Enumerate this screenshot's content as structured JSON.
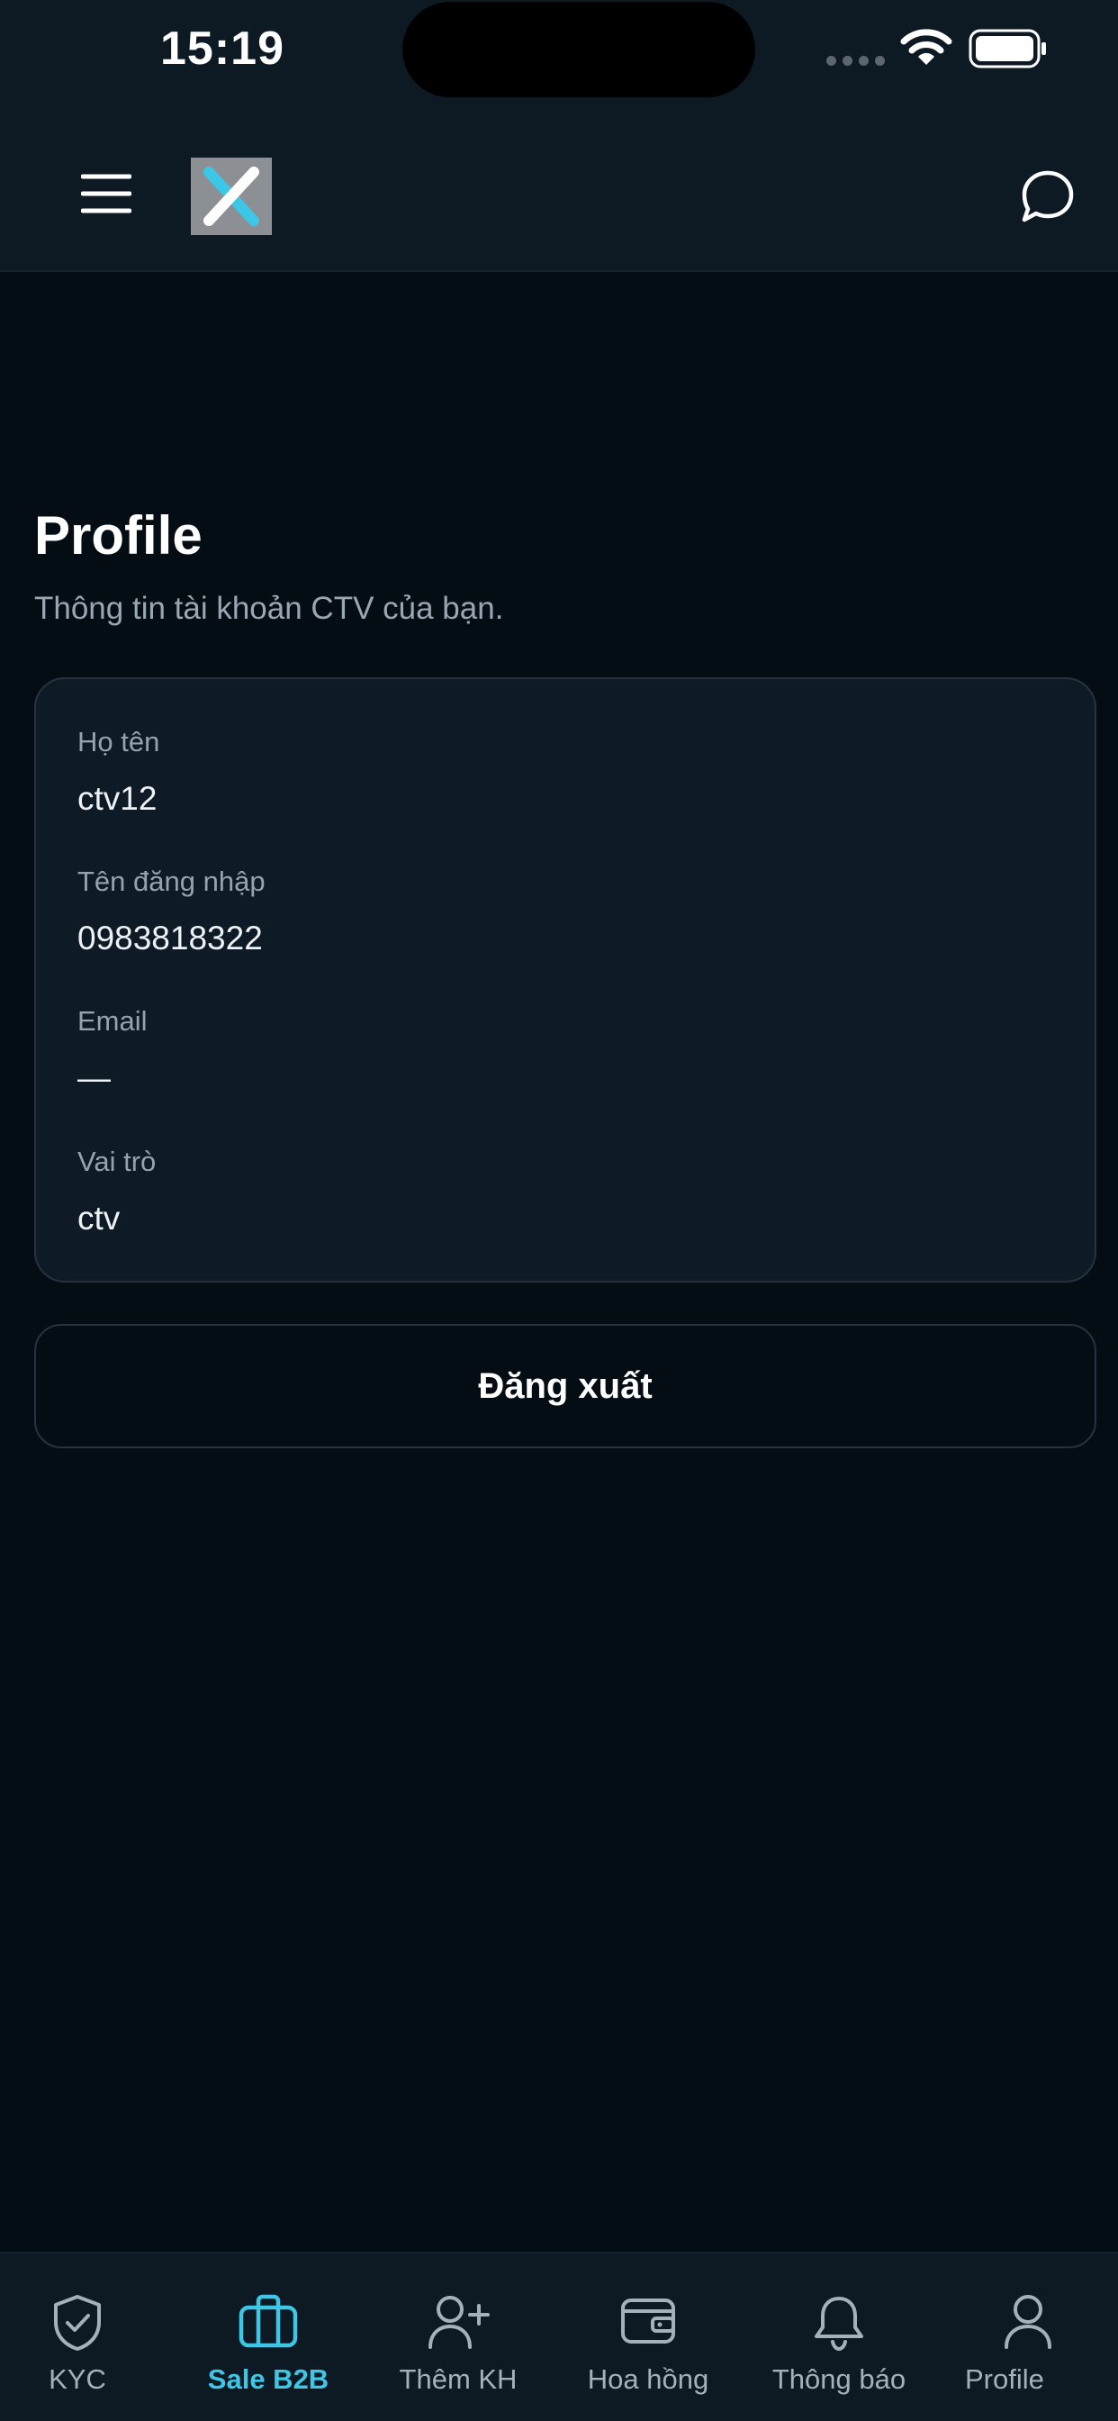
{
  "status_bar": {
    "time": "15:19"
  },
  "header": {
    "menu_icon": "hamburger-menu-icon",
    "logo": "x-logo",
    "chat_icon": "chat-bubble-icon"
  },
  "page": {
    "title": "Profile",
    "subtitle": "Thông tin tài khoản CTV của bạn."
  },
  "profile_fields": [
    {
      "label": "Họ tên",
      "value": "ctv12"
    },
    {
      "label": "Tên đăng nhập",
      "value": "0983818322"
    },
    {
      "label": "Email",
      "value": "—"
    },
    {
      "label": "Vai trò",
      "value": "ctv"
    }
  ],
  "logout_button": {
    "label": "Đăng xuất"
  },
  "bottom_nav": {
    "active_index": 1,
    "items": [
      {
        "label": "KYC",
        "icon": "shield-check-icon"
      },
      {
        "label": "Sale B2B",
        "icon": "briefcase-icon"
      },
      {
        "label": "Thêm KH",
        "icon": "user-plus-icon"
      },
      {
        "label": "Hoa hồng",
        "icon": "wallet-icon"
      },
      {
        "label": "Thông báo",
        "icon": "bell-icon"
      },
      {
        "label": "Profile",
        "icon": "user-icon"
      }
    ]
  },
  "colors": {
    "background": "#040d14",
    "surface": "#0d1a24",
    "card": "#0e1a25",
    "border": "#26333f",
    "accent": "#3ec6e6",
    "muted_text": "#9aa6b2",
    "logo_bg": "#8c8f93",
    "logo_x": "#3ec6e6"
  }
}
